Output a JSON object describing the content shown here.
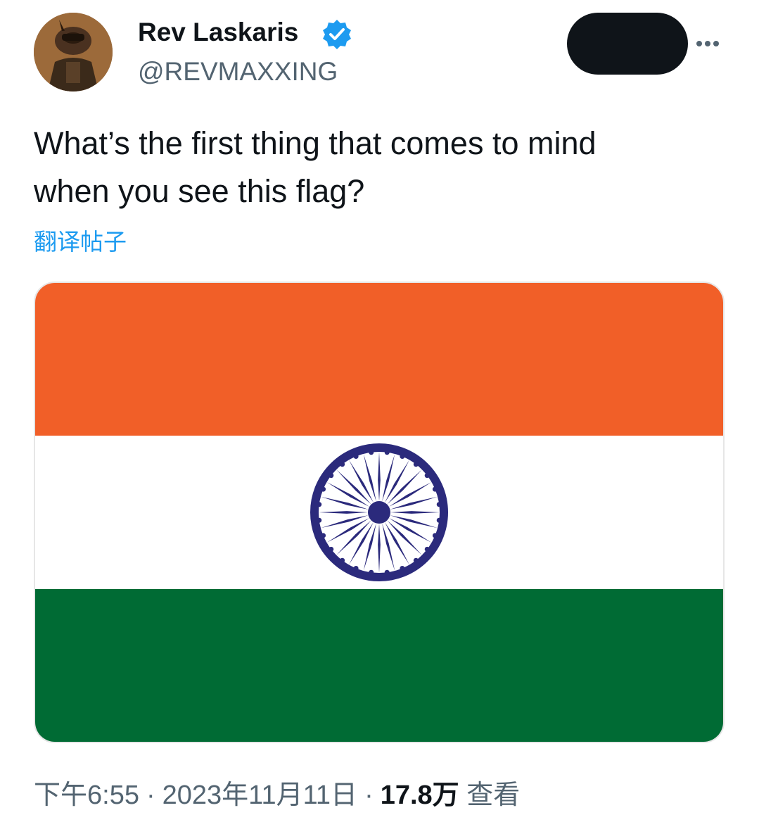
{
  "tweet": {
    "author": {
      "display_name": "Rev Laskaris",
      "handle": "@REVMAXXING",
      "verified": true,
      "verified_icon": "verified-badge-icon",
      "avatar_icon": "soldier-avatar"
    },
    "text_line1": "What’s the first thing that comes to mind",
    "text_line2": "when you see this flag?",
    "translate_label": "翻译帖子",
    "media": {
      "type": "flag-image",
      "stripe_colors": [
        "#f15f28",
        "#ffffff",
        "#006b34"
      ],
      "wheel_color": "#2b2a7c",
      "wheel_spokes": 24
    },
    "time": "下午6:55",
    "date": "2023年11月11日",
    "views_count": "17.8万",
    "views_label": "查看",
    "separator": "·"
  },
  "colors": {
    "accent": "#1d9bf0",
    "text_primary": "#0f1419",
    "text_secondary": "#536471"
  }
}
